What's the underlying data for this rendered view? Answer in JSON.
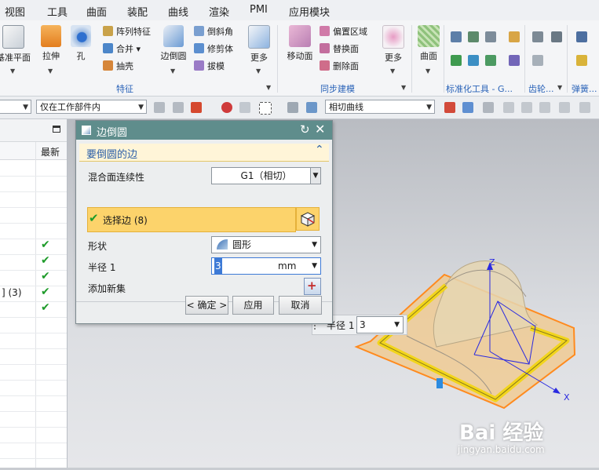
{
  "menubar": {
    "items": [
      "视图",
      "工具",
      "曲面",
      "装配",
      "曲线",
      "渲染",
      "PMI",
      "应用模块"
    ]
  },
  "ribbon": {
    "big_buttons": [
      "基准平面",
      "拉伸",
      "孔",
      "边倒圆",
      "更多",
      "移动面",
      "更多",
      "曲面"
    ],
    "small_buttons": [
      "阵列特征",
      "合并",
      "抽壳",
      "倒斜角",
      "修剪体",
      "拔模",
      "偏置区域",
      "替换面",
      "删除面"
    ],
    "groups": [
      "特征",
      "同步建模",
      "标准化工具 - G...",
      "齿轮...",
      "弹簧..."
    ]
  },
  "toolbar2": {
    "filter_scope": "仅在工作部件内",
    "curve_rule": "相切曲线"
  },
  "left_panel": {
    "column_header": "最新",
    "row_text": "] (3)",
    "check_rows": 5
  },
  "dialog": {
    "title": "边倒圆",
    "section_title": "要倒圆的边",
    "continuity_label": "混合面连续性",
    "continuity_value": "G1（相切）",
    "select_edge_label": "选择边 (8)",
    "shape_label": "形状",
    "shape_value": "圆形",
    "radius_label": "半径 1",
    "radius_value": "3",
    "radius_unit": "mm",
    "add_set_label": "添加新集",
    "ok_label": "< 确定 >",
    "apply_label": "应用",
    "cancel_label": "取消"
  },
  "viewport": {
    "overlay_label": "半径 1",
    "overlay_value": "3",
    "axis_z": "Z",
    "axis_x": "X"
  },
  "watermark": {
    "brand": "Bai 经验",
    "site": "jingyan.baidu.com"
  },
  "colors": {
    "dialog_title_bg": "#5f8d8c",
    "selected_row": "#fcd36b",
    "section_header_bg": "#fff5d8",
    "check_green": "#1e9b2a",
    "highlight_edge": "#f2d51c",
    "preview_orange": "#ff8a1e"
  }
}
